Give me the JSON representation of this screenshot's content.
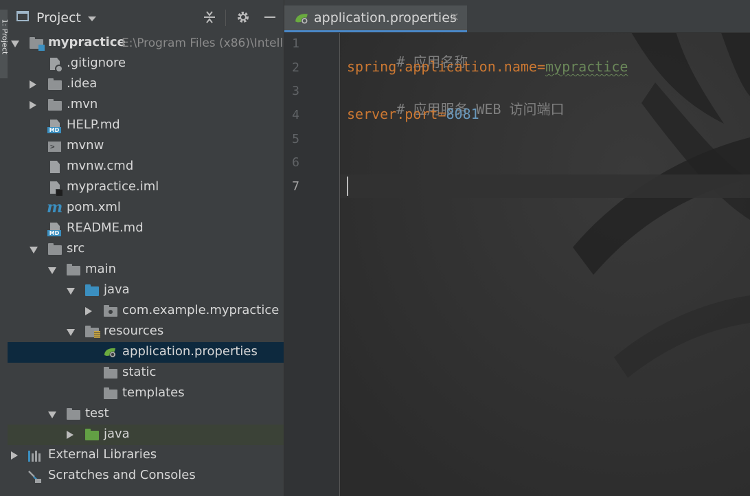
{
  "tool_stripe": {
    "label": "1: Project"
  },
  "panel": {
    "title": "Project",
    "tree": [
      {
        "name": "mypractice",
        "path": "E:\\Program Files (x86)\\Intell",
        "bold": true
      },
      {
        "name": ".gitignore"
      },
      {
        "name": ".idea"
      },
      {
        "name": ".mvn"
      },
      {
        "name": "HELP.md"
      },
      {
        "name": "mvnw"
      },
      {
        "name": "mvnw.cmd"
      },
      {
        "name": "mypractice.iml"
      },
      {
        "name": "pom.xml"
      },
      {
        "name": "README.md"
      },
      {
        "name": "src"
      },
      {
        "name": "main"
      },
      {
        "name": "java"
      },
      {
        "name": "com.example.mypractice"
      },
      {
        "name": "resources"
      },
      {
        "name": "application.properties"
      },
      {
        "name": "static"
      },
      {
        "name": "templates"
      },
      {
        "name": "test"
      },
      {
        "name": "java"
      },
      {
        "name": "External Libraries"
      },
      {
        "name": "Scratches and Consoles"
      }
    ]
  },
  "editor": {
    "tab": {
      "label": "application.properties",
      "close": "×"
    },
    "line_numbers": [
      "1",
      "2",
      "3",
      "4",
      "5",
      "6",
      "7"
    ],
    "lines": {
      "l1": "# 应用名称",
      "l2_key": "spring.application.name",
      "l2_eq": "=",
      "l2_val": "mypractice",
      "l3": "# 应用服务 WEB 访问端口",
      "l4_key": "server.port",
      "l4_eq": "=",
      "l4_val": "8081"
    }
  },
  "icons": {
    "project-view": "project-icon",
    "collapse-all": "collapse-all-icon",
    "settings": "gear-icon",
    "hide": "minimize-icon"
  },
  "colors": {
    "panel_bg": "#3c3f41",
    "editor_bg": "#2b2b2b",
    "selection": "#0d293e",
    "keyword": "#cc7832",
    "string": "#6a8759",
    "number": "#6897bb",
    "comment": "#808080",
    "accent": "#4a88c7"
  }
}
